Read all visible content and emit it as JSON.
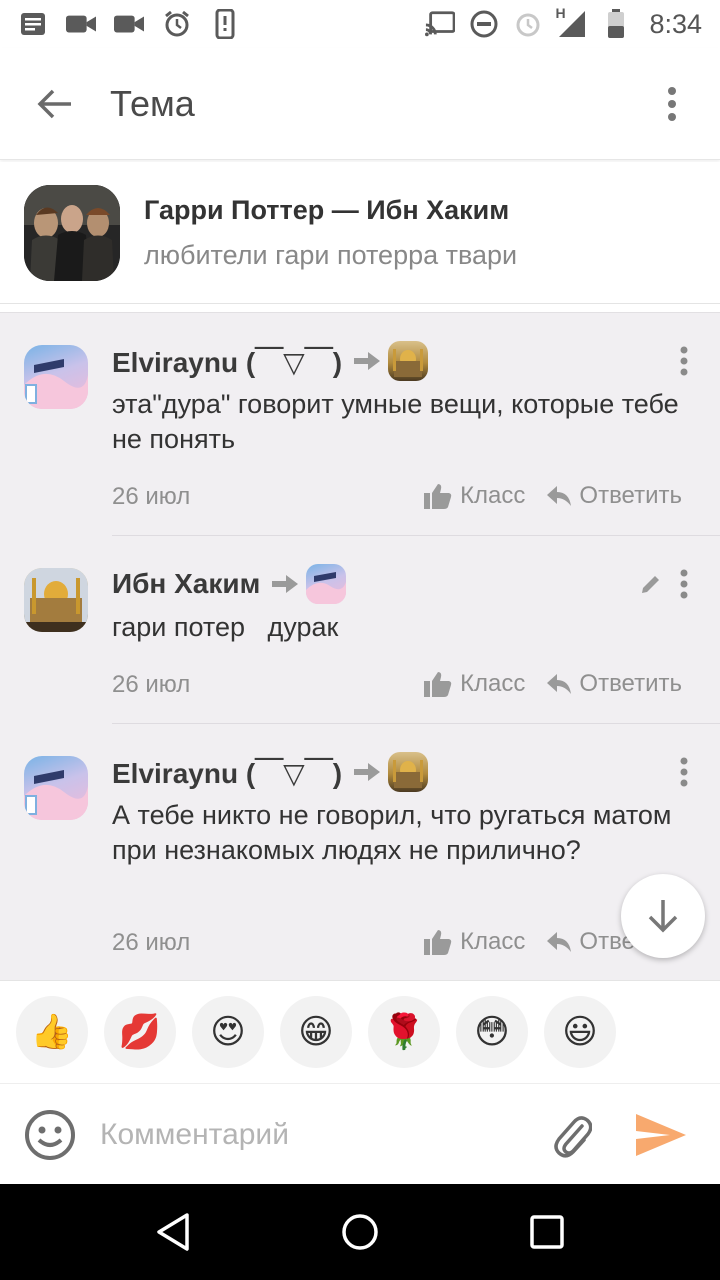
{
  "status_bar": {
    "time": "8:34",
    "network_label": "H",
    "left_icons": [
      "notes-icon",
      "video-icon",
      "video-icon",
      "alarm-icon",
      "device-icon"
    ],
    "right_icons": [
      "cast-icon",
      "dnd-icon",
      "alarm-icon",
      "signal-icon",
      "battery-icon"
    ]
  },
  "app_bar": {
    "title": "Тема",
    "back_icon": "arrow-back-icon",
    "more_icon": "more-vert-icon"
  },
  "topic": {
    "title": "Гарри Поттер — Ибн Хаким",
    "subtitle": "любители гари потерра твари"
  },
  "comments": [
    {
      "author": "Elviraynu (￣▽￣)",
      "reply_to_avatar": "gold",
      "text": "эта\"дура\" говорит умные вещи, которые тебе не понять",
      "date": "26 июл",
      "like_label": "Класс",
      "reply_label": "Ответить",
      "avatar": "pink",
      "editable": false
    },
    {
      "author": "Ибн Хаким",
      "reply_to_avatar": "pink",
      "text": "гари потер   дурак",
      "date": "26 июл",
      "like_label": "Класс",
      "reply_label": "Ответить",
      "avatar": "gold",
      "editable": true
    },
    {
      "author": "Elviraynu (￣▽￣)",
      "reply_to_avatar": "gold",
      "text": "А тебе никто не говорил, что ругаться матом при незнакомых людях не прилично?",
      "date": "26 июл",
      "like_label": "Класс",
      "reply_label": "Ответить",
      "avatar": "pink",
      "editable": false
    }
  ],
  "reactions": [
    "👍",
    "💋",
    "😍",
    "😁",
    "🌹",
    "😳",
    "😃"
  ],
  "composer": {
    "placeholder": "Комментарий",
    "emoji_icon": "smiley-icon",
    "attach_icon": "paperclip-icon",
    "send_icon": "send-icon"
  },
  "colors": {
    "accent_orange": "#f8a96e",
    "comments_bg": "#f1eff2",
    "text_muted": "#8f8f8f",
    "icon_grey": "#9a9a9a"
  }
}
